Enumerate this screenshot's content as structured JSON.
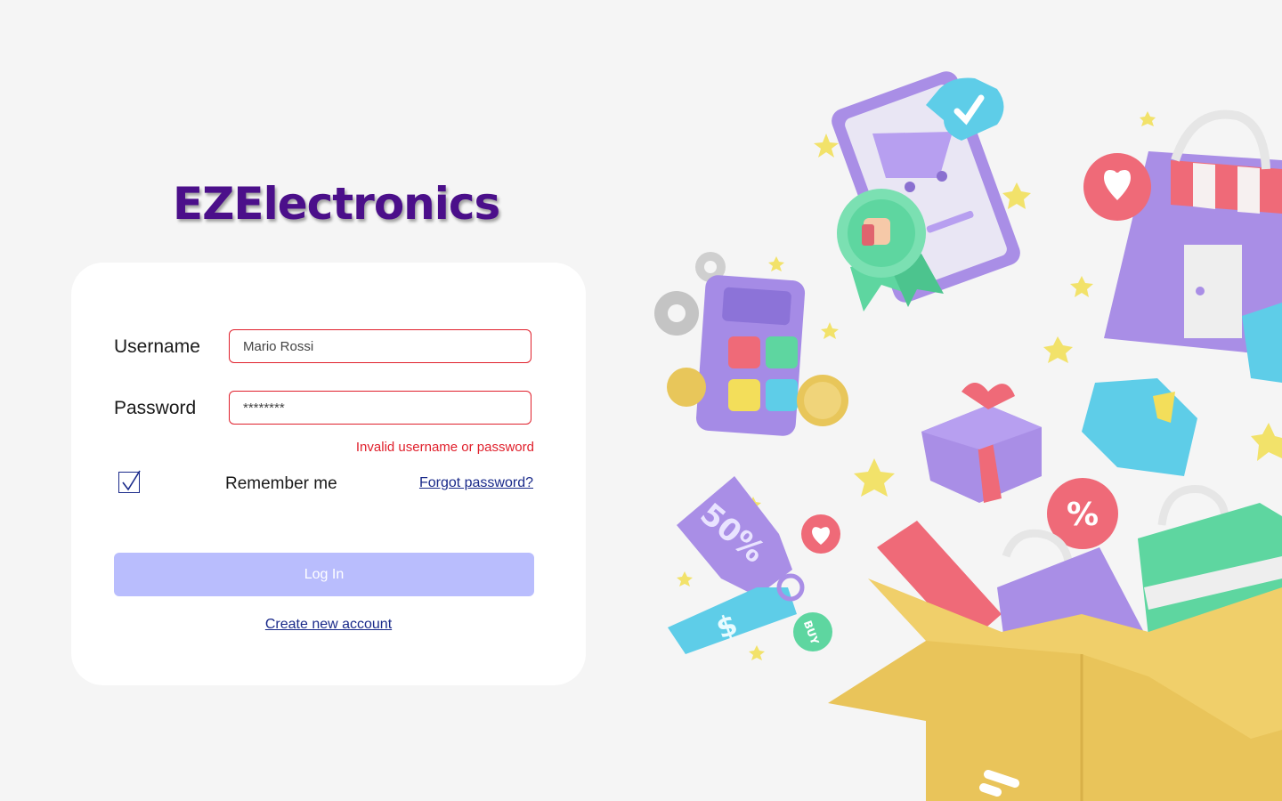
{
  "brand": {
    "logo_text": "EZElectronics"
  },
  "login_form": {
    "username_label": "Username",
    "username_value": "Mario Rossi",
    "password_label": "Password",
    "password_value": "********",
    "error_message": "Invalid username or password",
    "remember_me_label": "Remember me",
    "remember_me_checked": true,
    "forgot_password_link": "Forgot password?",
    "login_button_label": "Log In",
    "create_account_link": "Create new account"
  },
  "illustration": {
    "tag_text": "50%",
    "tag_dollar": "$",
    "buy_badge": "BUY",
    "percent_sign": "%",
    "icons": [
      "shopping-box-icon",
      "gift-icon",
      "calculator-icon",
      "shopping-bag-icon",
      "store-icon",
      "phone-cart-icon",
      "thumbs-up-badge-icon",
      "star-icon",
      "coin-icon",
      "gear-icon",
      "heart-bubble-icon",
      "check-bubble-icon",
      "discount-badge-icon",
      "ticket-icon",
      "package-icon"
    ]
  },
  "colors": {
    "logo": "#4b0f8a",
    "error": "#e0202c",
    "link": "#1a2a8a",
    "login_button": "#b9bdfd",
    "background": "#f5f5f5",
    "card": "#ffffff"
  }
}
